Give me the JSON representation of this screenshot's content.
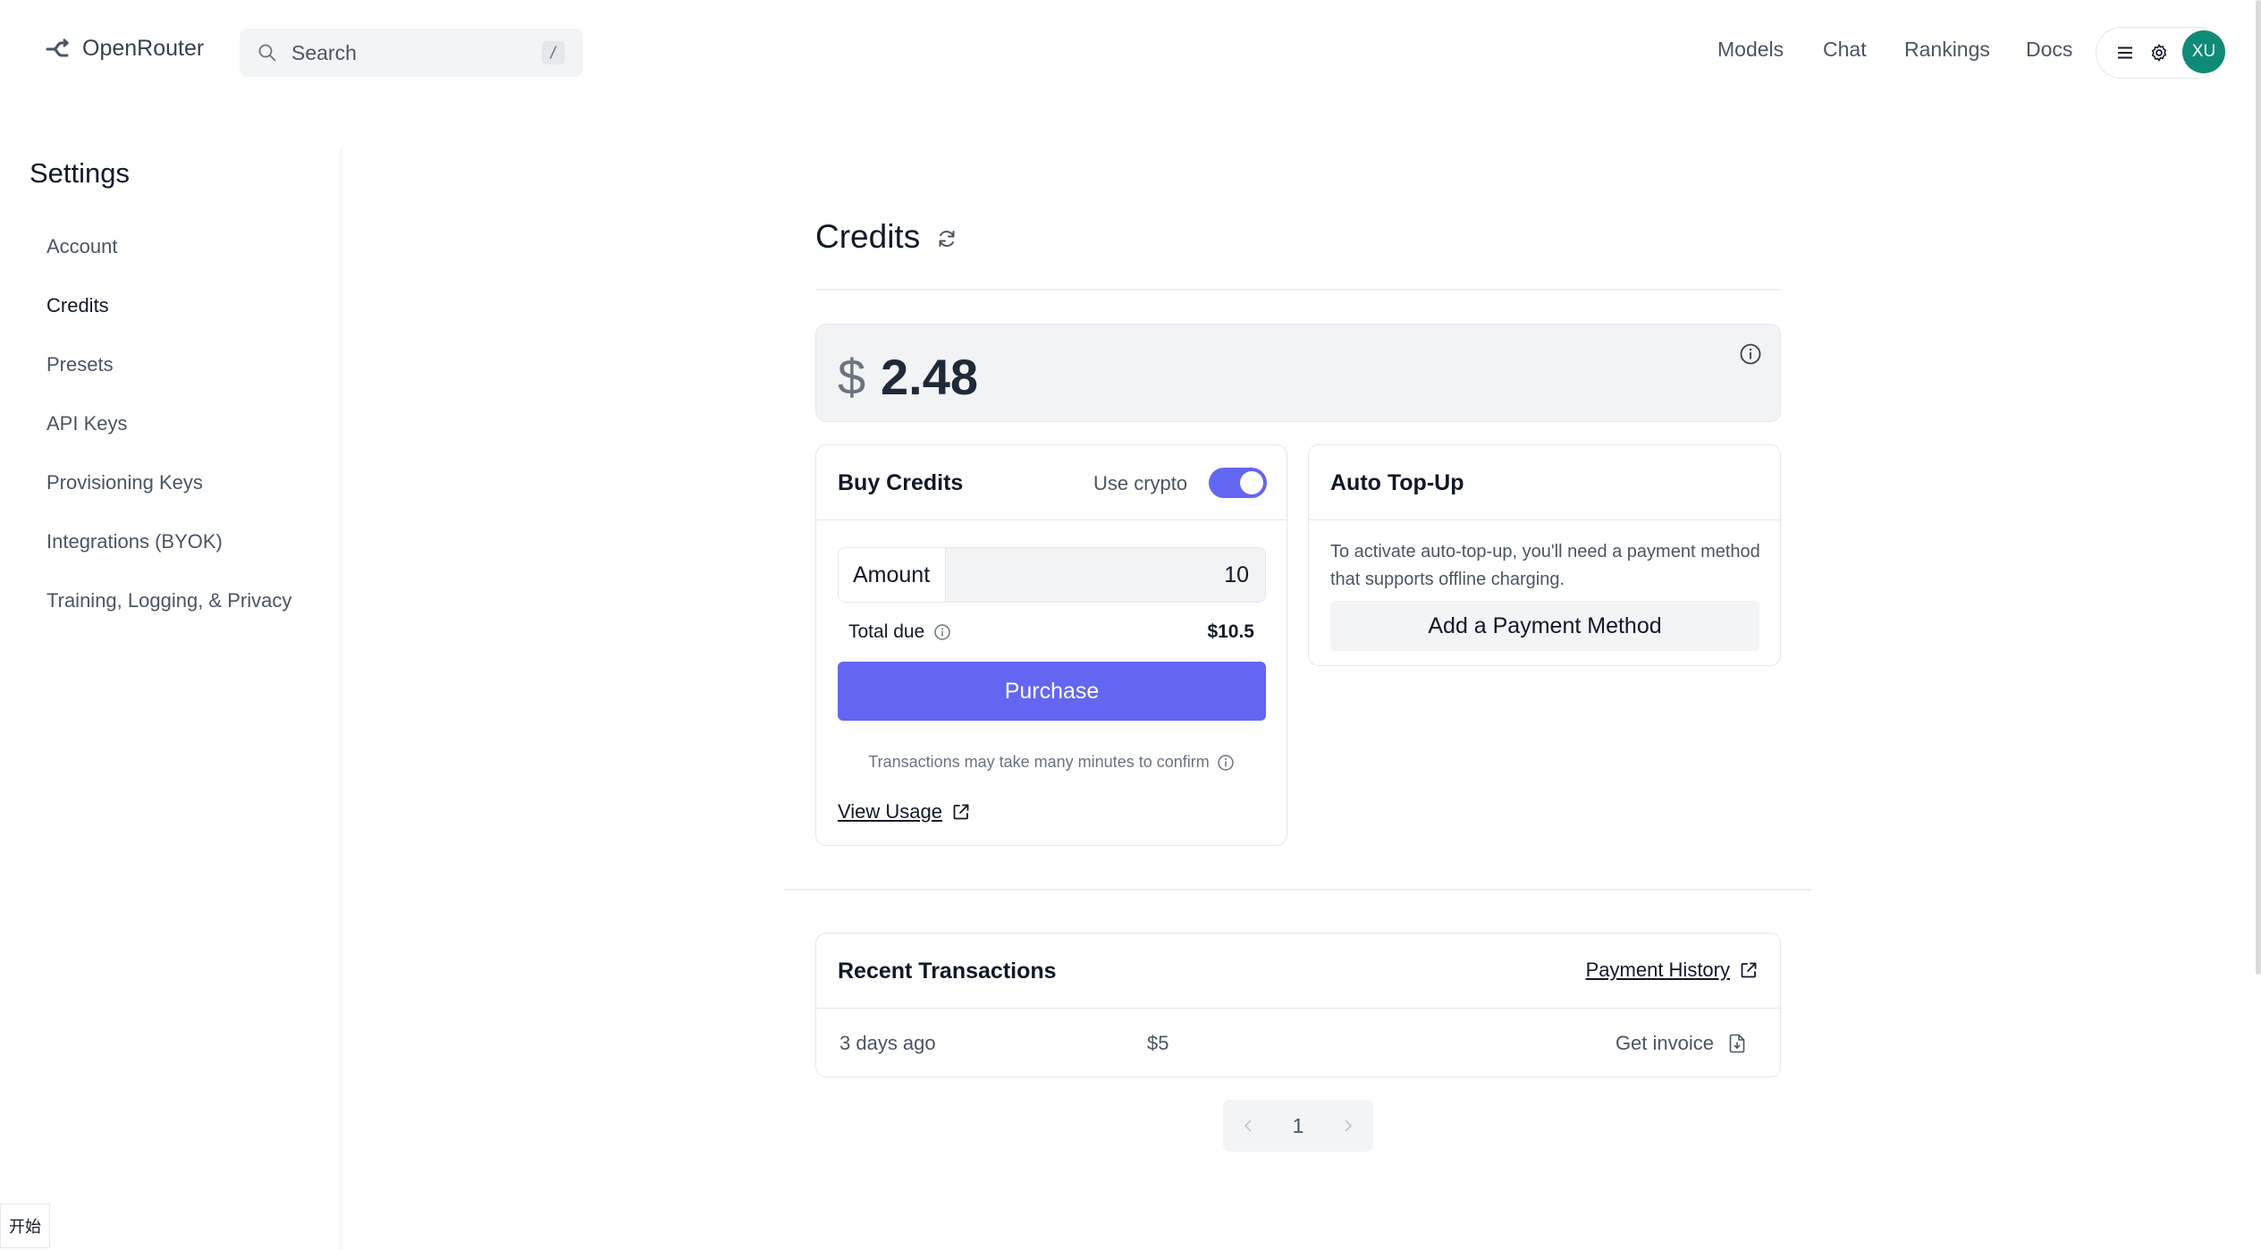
{
  "header": {
    "brand": "OpenRouter",
    "search_placeholder": "Search",
    "search_shortcut": "/",
    "nav": [
      "Models",
      "Chat",
      "Rankings",
      "Docs"
    ],
    "avatar_initials": "XU"
  },
  "sidebar": {
    "title": "Settings",
    "items": [
      {
        "label": "Account"
      },
      {
        "label": "Credits",
        "active": true
      },
      {
        "label": "Presets"
      },
      {
        "label": "API Keys"
      },
      {
        "label": "Provisioning Keys"
      },
      {
        "label": "Integrations (BYOK)"
      },
      {
        "label": "Training, Logging, & Privacy"
      }
    ]
  },
  "main": {
    "title": "Credits",
    "balance": {
      "currency": "$",
      "amount": "2.48"
    },
    "buy_credits": {
      "title": "Buy Credits",
      "crypto_label": "Use crypto",
      "crypto_enabled": true,
      "amount_label": "Amount",
      "amount_value": "10",
      "total_label": "Total due",
      "total_value": "$10.5",
      "purchase_label": "Purchase",
      "note": "Transactions may take many minutes to confirm",
      "view_usage": "View Usage"
    },
    "auto_topup": {
      "title": "Auto Top-Up",
      "description": "To activate auto-top-up, you'll need a payment method that supports offline charging.",
      "button": "Add a Payment Method"
    },
    "transactions": {
      "title": "Recent Transactions",
      "history_link": "Payment History",
      "rows": [
        {
          "when": "3 days ago",
          "amount": "$5",
          "action": "Get invoice"
        }
      ]
    },
    "pagination": {
      "current": "1"
    }
  },
  "taskbar": {
    "start_label": "开始"
  },
  "colors": {
    "accent": "#6366f1",
    "avatar": "#0f8a76"
  }
}
